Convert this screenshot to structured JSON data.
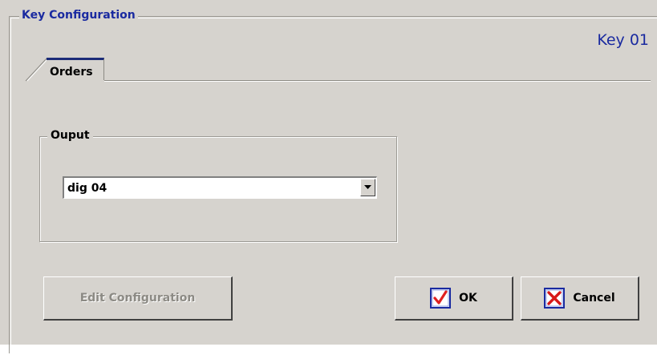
{
  "dialog": {
    "group_title": "Key Configuration",
    "key_label": "Key 01"
  },
  "tabs": [
    {
      "label": "Orders",
      "active": true
    }
  ],
  "output_group": {
    "title": "Ouput",
    "combo": {
      "value": "dig 04",
      "icon": "chevron-down-icon"
    }
  },
  "buttons": {
    "edit_label": "Edit Configuration",
    "ok_label": "OK",
    "cancel_label": "Cancel",
    "ok_icon": "checkmark-icon",
    "cancel_icon": "x-icon",
    "ok_icon_color": "#e02020",
    "cancel_icon_color": "#d81818",
    "icon_frame_color": "#1a2aa0"
  },
  "colors": {
    "background": "#d6d3ce",
    "title_blue": "#1a2aa0",
    "tab_accent": "#1c2c78"
  }
}
